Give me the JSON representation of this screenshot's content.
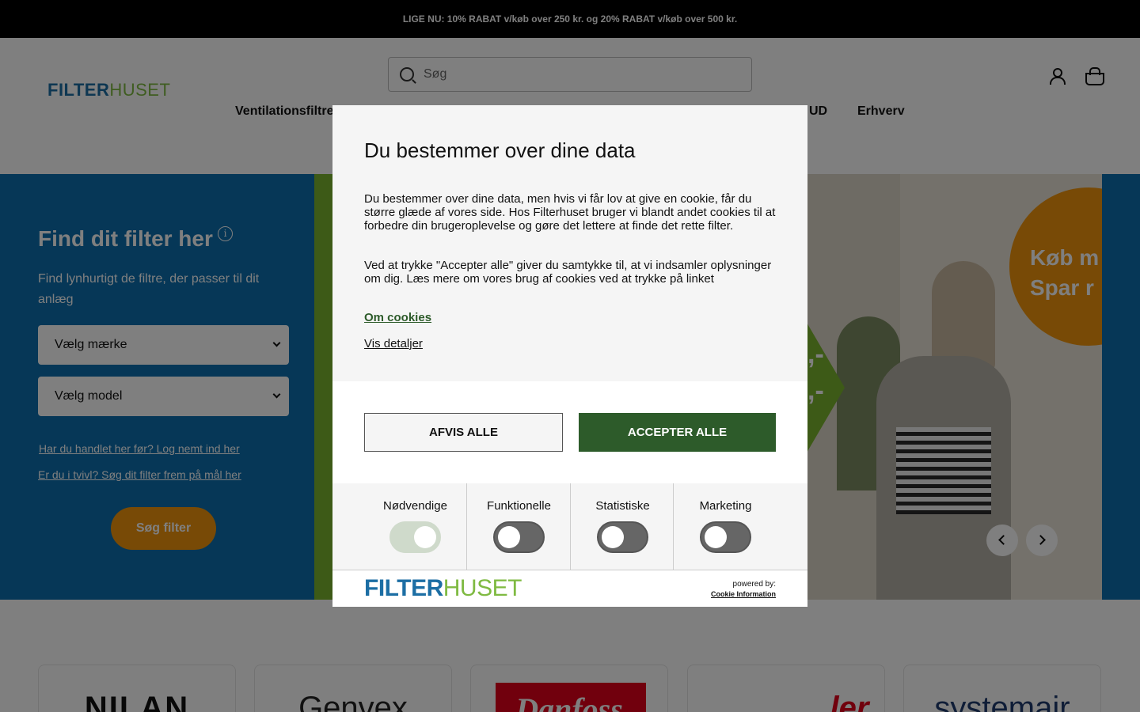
{
  "announcement": "LIGE NU: 10% RABAT v/køb over 250 kr. og 20% RABAT v/køb over 500 kr.",
  "header": {
    "logo_part1": "FILTER",
    "logo_part2": "HUSET",
    "search_placeholder": "Søg",
    "nav": [
      "Ventilationsfiltre",
      "UD",
      "Erhverv"
    ]
  },
  "finder": {
    "title": "Find dit filter her",
    "info_glyph": "i",
    "subtitle": "Find lynhurtigt de filtre, der passer til dit anlæg",
    "brand_select": "Vælg mærke",
    "model_select": "Vælg model",
    "login_link": "Har du handlet her før? Log nemt ind her",
    "measure_link": "Er du i tvivl? Søg dit filter frem på mål her",
    "search_button": "Søg filter"
  },
  "banner": {
    "price_line1": ",-",
    "price_line2": ",-",
    "badge_line1": "Køb m",
    "badge_line2": "Spar r"
  },
  "brands": [
    "NILAN",
    "Genvex",
    "Danfoss",
    "ler",
    "systemair"
  ],
  "cookie_modal": {
    "title": "Du bestemmer over dine data",
    "paragraph1": "Du bestemmer over dine data, men hvis vi får lov at give en cookie, får du større glæde af vores side. Hos Filterhuset bruger vi blandt andet cookies til at forbedre din brugeroplevelse og gøre det lettere at finde det rette filter.",
    "paragraph2": "Ved at trykke \"Accepter alle\" giver du samtykke til, at vi indsamler oplysninger om dig. Læs mere om vores brug af cookies ved at trykke på linket",
    "about_link": "Om cookies",
    "details_link": "Vis detaljer",
    "reject_button": "AFVIS ALLE",
    "accept_button": "ACCEPTER ALLE",
    "categories": [
      {
        "label": "Nødvendige",
        "enabled": true
      },
      {
        "label": "Funktionelle",
        "enabled": false
      },
      {
        "label": "Statistiske",
        "enabled": false
      },
      {
        "label": "Marketing",
        "enabled": false
      }
    ],
    "footer_logo_part1": "FILTER",
    "footer_logo_part2": "HUSET",
    "powered_by": "powered by:",
    "provider": "Cookie Information"
  },
  "colors": {
    "hero_blue": "#0c6fae",
    "accent_orange": "#f0950d",
    "accept_green": "#2d5b2a",
    "logo_blue": "#1c6ea4",
    "logo_green": "#7fba42"
  }
}
